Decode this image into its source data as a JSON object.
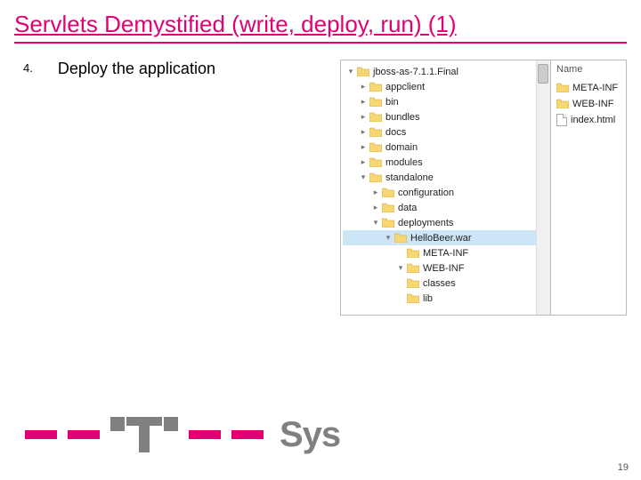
{
  "title": "Servlets Demystified (write, deploy, run) (1)",
  "step_number": "4.",
  "step_text": "Deploy the application",
  "page_number": "19",
  "tree": [
    {
      "label": "jboss-as-7.1.1.Final",
      "indent": 0,
      "twisty": "open",
      "selected": false
    },
    {
      "label": "appclient",
      "indent": 1,
      "twisty": "closed",
      "selected": false
    },
    {
      "label": "bin",
      "indent": 1,
      "twisty": "closed",
      "selected": false
    },
    {
      "label": "bundles",
      "indent": 1,
      "twisty": "closed",
      "selected": false
    },
    {
      "label": "docs",
      "indent": 1,
      "twisty": "closed",
      "selected": false
    },
    {
      "label": "domain",
      "indent": 1,
      "twisty": "closed",
      "selected": false
    },
    {
      "label": "modules",
      "indent": 1,
      "twisty": "closed",
      "selected": false
    },
    {
      "label": "standalone",
      "indent": 1,
      "twisty": "open",
      "selected": false
    },
    {
      "label": "configuration",
      "indent": 2,
      "twisty": "closed",
      "selected": false
    },
    {
      "label": "data",
      "indent": 2,
      "twisty": "closed",
      "selected": false
    },
    {
      "label": "deployments",
      "indent": 2,
      "twisty": "open",
      "selected": false
    },
    {
      "label": "HelloBeer.war",
      "indent": 3,
      "twisty": "open",
      "selected": true
    },
    {
      "label": "META-INF",
      "indent": 4,
      "twisty": "none",
      "selected": false
    },
    {
      "label": "WEB-INF",
      "indent": 4,
      "twisty": "open",
      "selected": false
    },
    {
      "label": "classes",
      "indent": 4,
      "twisty": "none",
      "selected": false
    },
    {
      "label": "lib",
      "indent": 4,
      "twisty": "none",
      "selected": false
    }
  ],
  "details_header": "Name",
  "details": [
    {
      "type": "folder",
      "label": "META-INF"
    },
    {
      "type": "folder",
      "label": "WEB-INF"
    },
    {
      "type": "file",
      "label": "index.html"
    }
  ],
  "logo_text": "Sys"
}
